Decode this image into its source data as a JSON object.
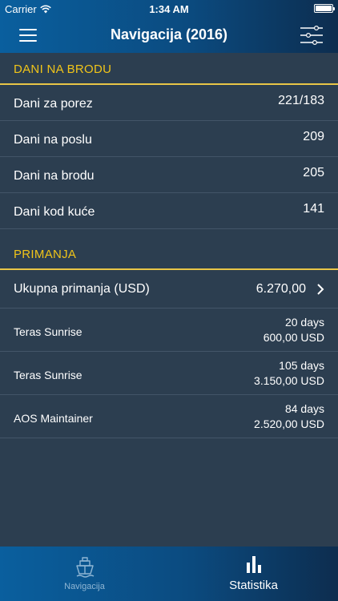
{
  "status_bar": {
    "carrier": "Carrier",
    "time": "1:34 AM"
  },
  "nav": {
    "title": "Navigacija (2016)",
    "menu_icon": "hamburger-menu-icon",
    "filter_icon": "sliders-icon"
  },
  "section_days": {
    "header": "DANI NA BRODU",
    "rows": [
      {
        "label": "Dani za porez",
        "value": "221/183"
      },
      {
        "label": "Dani na poslu",
        "value": "209"
      },
      {
        "label": "Dani na brodu",
        "value": "205"
      },
      {
        "label": "Dani kod kuće",
        "value": "141"
      }
    ]
  },
  "section_income": {
    "header": "PRIMANJA",
    "total": {
      "label": "Ukupna primanja (USD)",
      "value": "6.270,00"
    },
    "items": [
      {
        "label": "Teras Sunrise",
        "days": "20 days",
        "amount": "600,00 USD"
      },
      {
        "label": "Teras Sunrise",
        "days": "105 days",
        "amount": "3.150,00 USD"
      },
      {
        "label": "AOS Maintainer",
        "days": "84 days",
        "amount": "2.520,00 USD"
      }
    ]
  },
  "tabs": [
    {
      "label": "Navigacija",
      "icon": "ship-icon",
      "active": false
    },
    {
      "label": "Statistika",
      "icon": "bar-chart-icon",
      "active": true
    }
  ],
  "colors": {
    "accent": "#f0c419",
    "background": "#2c3e50",
    "bar_start": "#0a5f9e",
    "bar_end": "#0d2d4f"
  }
}
